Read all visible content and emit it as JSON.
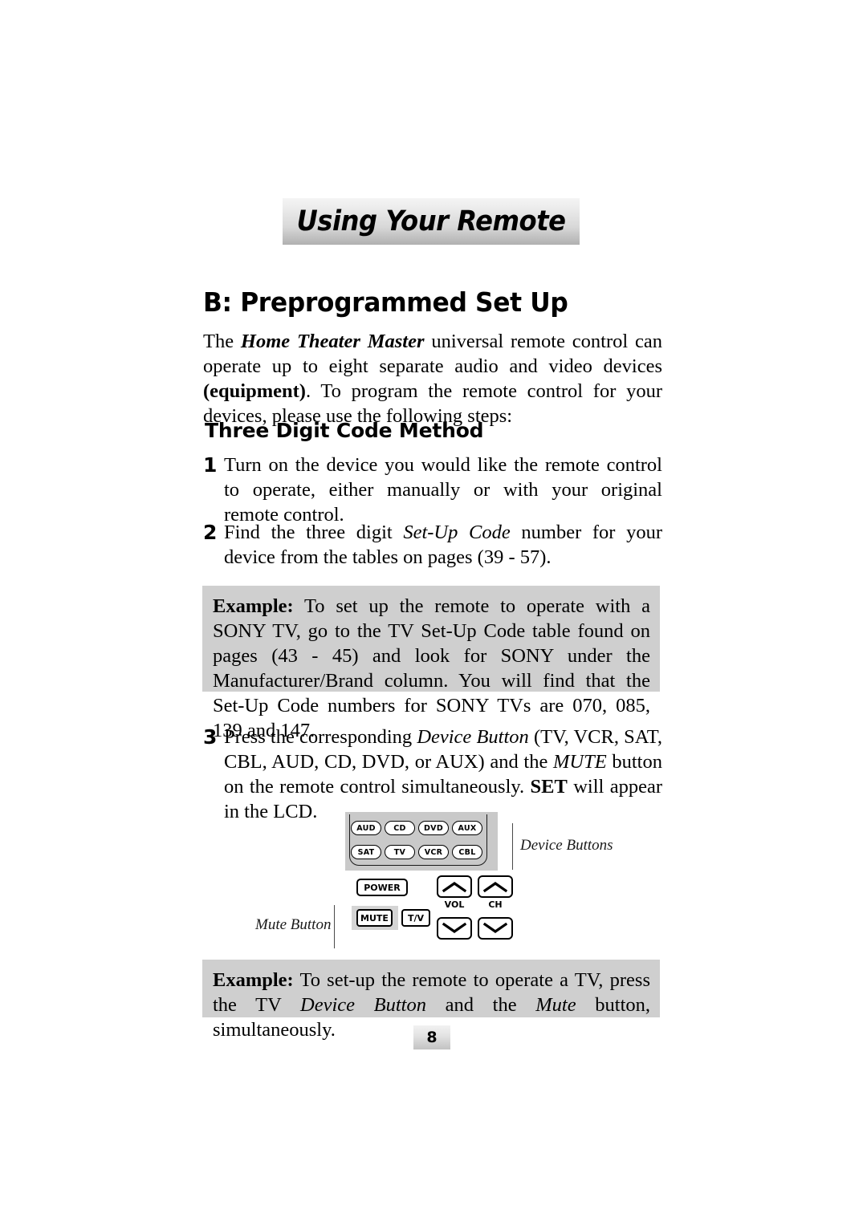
{
  "banner": {
    "title": "Using Your Remote"
  },
  "headings": {
    "section": "B: Preprogrammed Set Up",
    "subsection": "Three Digit Code Method"
  },
  "intro": {
    "prefix": "The ",
    "emphasis": "Home Theater Master",
    "middle": " universal remote control can operate up to eight separate audio and video devices ",
    "bold_term": "(equipment)",
    "suffix": ". To program the remote control for your devices, please use the following steps:"
  },
  "steps": [
    {
      "number": "1",
      "text": "Turn on the device you would like the remote control to operate, either manually or with your original remote control."
    },
    {
      "number": "2",
      "prefix": "Find the three digit ",
      "italic": "Set-Up Code",
      "suffix": " number for your device from the tables on pages (39 - 57)."
    },
    {
      "number": "3",
      "prefix": "Press the corresponding ",
      "italic": "Device Button",
      "middle": " (TV, VCR, SAT, CBL, AUD, CD, DVD, or AUX) and the ",
      "italic2": "MUTE",
      "middle2": " button on the remote control simultaneously. ",
      "bold": "SET",
      "suffix": " will appear in the LCD."
    }
  ],
  "examples": [
    {
      "label": "Example:",
      "text": " To set up the remote to operate with a SONY TV, go to the TV Set-Up Code table found on pages (43 - 45) and look for SONY under the Manufacturer/Brand column. You will find that the Set-Up Code numbers for SONY TVs are 070, 085, 139 and 147."
    },
    {
      "label": "Example:",
      "prefix": " To set-up the remote to operate a TV, press the TV ",
      "italic": "Device Button",
      "middle": " and the ",
      "italic2": "Mute",
      "suffix": " button, simultaneously."
    }
  ],
  "diagram": {
    "device_buttons_row1": [
      "AUD",
      "CD",
      "DVD",
      "AUX"
    ],
    "device_buttons_row2": [
      "SAT",
      "TV",
      "VCR",
      "CBL"
    ],
    "power_label": "POWER",
    "mute_label": "MUTE",
    "tv_toggle_label": "T/V",
    "vol_label": "VOL",
    "ch_label": "CH",
    "callout_mute": "Mute Button",
    "callout_device": "Device Buttons",
    "panel_color": "#c9c9c9",
    "highlight_color": "#d4d4d4"
  },
  "footer": {
    "page_number": "8"
  }
}
